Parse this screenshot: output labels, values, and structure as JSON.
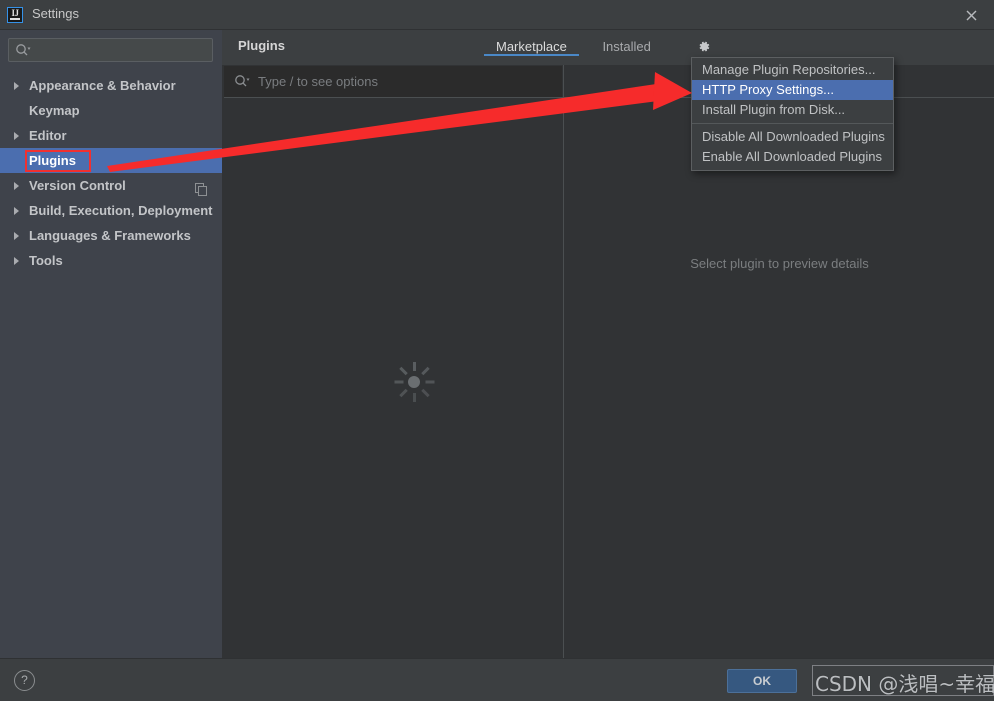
{
  "window": {
    "title": "Settings",
    "app_icon": "intellij-idea-icon",
    "close_icon": "close-icon"
  },
  "sidebar": {
    "search": {
      "placeholder": "",
      "value": "",
      "icon": "search-icon"
    },
    "items": [
      {
        "label": "Appearance & Behavior",
        "expandable": true,
        "selected": false
      },
      {
        "label": "Keymap",
        "expandable": false,
        "selected": false
      },
      {
        "label": "Editor",
        "expandable": true,
        "selected": false
      },
      {
        "label": "Plugins",
        "expandable": false,
        "selected": true
      },
      {
        "label": "Version Control",
        "expandable": true,
        "selected": false,
        "trailing_icon": "copy-icon"
      },
      {
        "label": "Build, Execution, Deployment",
        "expandable": true,
        "selected": false
      },
      {
        "label": "Languages & Frameworks",
        "expandable": true,
        "selected": false
      },
      {
        "label": "Tools",
        "expandable": true,
        "selected": false
      }
    ]
  },
  "main": {
    "header_title": "Plugins",
    "tabs": [
      {
        "label": "Marketplace",
        "active": true
      },
      {
        "label": "Installed",
        "active": false
      }
    ],
    "gear_icon": "gear-icon",
    "search": {
      "placeholder": "Type / to see options",
      "value": "",
      "icon": "search-icon"
    },
    "loading_indicator": "loading-spinner",
    "detail_empty_text": "Select plugin to preview details"
  },
  "gear_menu": {
    "items": [
      {
        "label": "Manage Plugin Repositories...",
        "highlighted": false,
        "separator_after": false
      },
      {
        "label": "HTTP Proxy Settings...",
        "highlighted": true,
        "separator_after": false
      },
      {
        "label": "Install Plugin from Disk...",
        "highlighted": false,
        "separator_after": true
      },
      {
        "label": "Disable All Downloaded Plugins",
        "highlighted": false,
        "separator_after": false
      },
      {
        "label": "Enable All Downloaded Plugins",
        "highlighted": false,
        "separator_after": false
      }
    ]
  },
  "footer": {
    "help_label": "?",
    "ok_label": "OK"
  },
  "annotations": {
    "arrow_color": "#f62b2b",
    "highlight_box_color": "#f03030",
    "watermark_text": "CSDN @浅唱~幸福"
  },
  "colors": {
    "selection_blue": "#4b6eaf",
    "tab_underline": "#4a88c7",
    "sidebar_bg": "#3f434b",
    "panel_bg": "#313335",
    "chrome_bg": "#3c3f41",
    "ok_button": "#365880"
  }
}
